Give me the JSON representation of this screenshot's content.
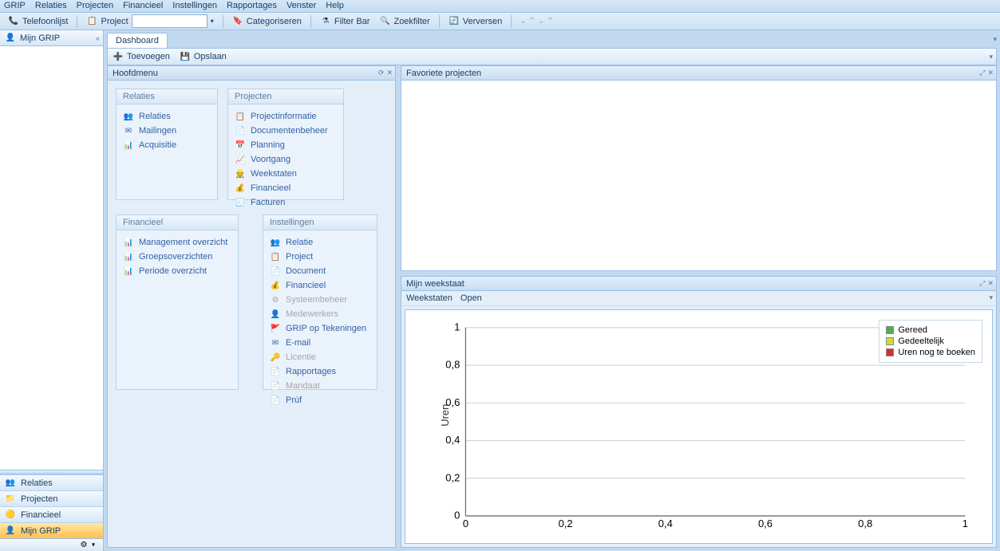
{
  "menus": [
    "GRIP",
    "Relaties",
    "Projecten",
    "Financieel",
    "Instellingen",
    "Rapportages",
    "Venster",
    "Help"
  ],
  "toolbar": {
    "telefoonlijst": "Telefoonlijst",
    "project": "Project",
    "categoriseren": "Categoriseren",
    "filterbar": "Filter Bar",
    "zoekfilter": "Zoekfilter",
    "verversen": "Verversen"
  },
  "sidebar": {
    "header": "Mijn GRIP",
    "nav": [
      {
        "label": "Relaties",
        "icon": "ic-people"
      },
      {
        "label": "Projecten",
        "icon": "ic-folder"
      },
      {
        "label": "Financieel",
        "icon": "ic-coin"
      },
      {
        "label": "Mijn GRIP",
        "icon": "ic-user",
        "active": true
      }
    ]
  },
  "tab": "Dashboard",
  "dashbar": {
    "toevoegen": "Toevoegen",
    "opslaan": "Opslaan"
  },
  "panels": {
    "hoofdmenu": "Hoofdmenu",
    "favoriete": "Favoriete projecten",
    "weekstaat": "Mijn weekstaat"
  },
  "groups": {
    "relaties": {
      "title": "Relaties",
      "items": [
        {
          "label": "Relaties",
          "icon": "ic-people"
        },
        {
          "label": "Mailingen",
          "icon": "ic-mail"
        },
        {
          "label": "Acquisitie",
          "icon": "ic-chart"
        }
      ]
    },
    "projecten": {
      "title": "Projecten",
      "items": [
        {
          "label": "Projectinformatie",
          "icon": "ic-proj"
        },
        {
          "label": "Documentenbeheer",
          "icon": "ic-doc"
        },
        {
          "label": "Planning",
          "icon": "ic-cal"
        },
        {
          "label": "Voortgang",
          "icon": "ic-prog"
        },
        {
          "label": "Weekstaten",
          "icon": "ic-week"
        },
        {
          "label": "Financieel",
          "icon": "ic-fin"
        },
        {
          "label": "Facturen",
          "icon": "ic-inv"
        }
      ]
    },
    "financieel": {
      "title": "Financieel",
      "items": [
        {
          "label": "Management overzicht",
          "icon": "ic-chart"
        },
        {
          "label": "Groepsoverzichten",
          "icon": "ic-chart"
        },
        {
          "label": "Periode overzicht",
          "icon": "ic-chart"
        }
      ]
    },
    "instellingen": {
      "title": "Instellingen",
      "items": [
        {
          "label": "Relatie",
          "icon": "ic-people",
          "disabled": false
        },
        {
          "label": "Project",
          "icon": "ic-proj",
          "disabled": false
        },
        {
          "label": "Document",
          "icon": "ic-doc",
          "disabled": false
        },
        {
          "label": "Financieel",
          "icon": "ic-fin",
          "disabled": false
        },
        {
          "label": "Systeembeheer",
          "icon": "ic-gear",
          "disabled": true
        },
        {
          "label": "Medewerkers",
          "icon": "ic-user",
          "disabled": true
        },
        {
          "label": "GRIP op Tekeningen",
          "icon": "ic-flag",
          "disabled": false
        },
        {
          "label": "E-mail",
          "icon": "ic-mail",
          "disabled": false
        },
        {
          "label": "Licentie",
          "icon": "ic-key",
          "disabled": true
        },
        {
          "label": "Rapportages",
          "icon": "ic-doc",
          "disabled": false
        },
        {
          "label": "Mandaat",
          "icon": "ic-doc",
          "disabled": true
        },
        {
          "label": "Prúf",
          "icon": "ic-doc",
          "disabled": false
        }
      ]
    }
  },
  "weektabs": [
    "Weekstaten",
    "Open"
  ],
  "chart_data": {
    "type": "line",
    "ylabel": "Uren",
    "xlim": [
      0,
      1
    ],
    "ylim": [
      0,
      1
    ],
    "xticks": [
      0,
      0.2,
      0.4,
      0.6,
      0.8,
      1
    ],
    "yticks": [
      0,
      0.2,
      0.4,
      0.6,
      0.8,
      1
    ],
    "series": [
      {
        "name": "Gereed",
        "color": "#4caf50",
        "values": []
      },
      {
        "name": "Gedeeltelijk",
        "color": "#cddc39",
        "values": []
      },
      {
        "name": "Uren nog te boeken",
        "color": "#d32f2f",
        "values": []
      }
    ]
  }
}
